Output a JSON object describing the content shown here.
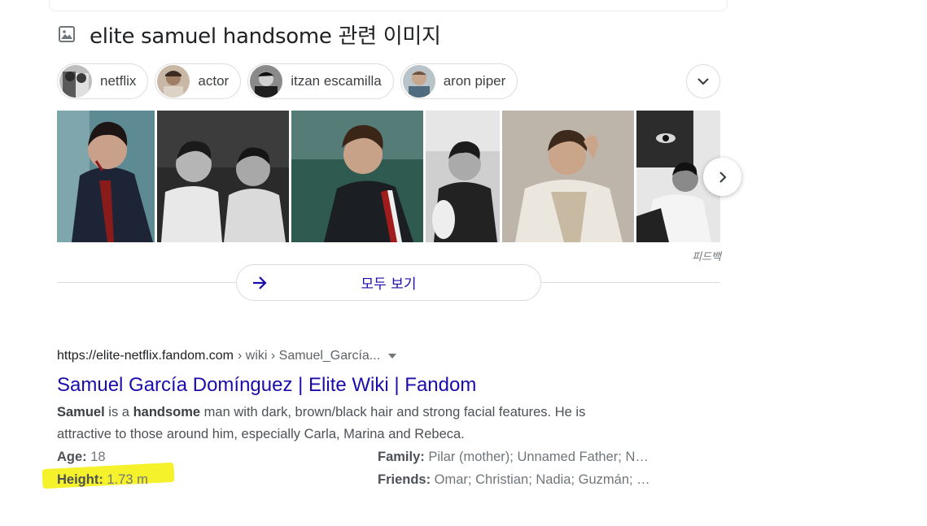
{
  "images_section": {
    "heading": "elite samuel handsome 관련 이미지",
    "heading_icon": "image-icon",
    "chips": [
      {
        "label": "netflix"
      },
      {
        "label": "actor"
      },
      {
        "label": "itzan escamilla"
      },
      {
        "label": "aron piper"
      }
    ],
    "feedback_label": "피드백",
    "see_all_label": "모두 보기"
  },
  "result": {
    "url": "https://elite-netflix.fandom.com",
    "breadcrumbs": "› wiki › Samuel_García...",
    "title": "Samuel García Domínguez | Elite Wiki | Fandom",
    "snippet": {
      "b1": "Samuel",
      "t1": " is a ",
      "b2": "handsome",
      "t2": " man with dark, brown/black hair and strong facial features. He is attractive to those around him, especially Carla, Marina and Rebeca."
    },
    "facts": {
      "age_label": "Age:",
      "age_value": " 18",
      "height_label": "Height:",
      "height_value": " 1.73 m",
      "family_label": "Family:",
      "family_value": " Pilar (mother); Unnamed Father; N…",
      "friends_label": "Friends:",
      "friends_value": " Omar; Christian; Nadia; Guzmán; …"
    }
  },
  "colors": {
    "link": "#1a0dab",
    "highlighter": "#f5f12a",
    "border": "#dadce0"
  }
}
